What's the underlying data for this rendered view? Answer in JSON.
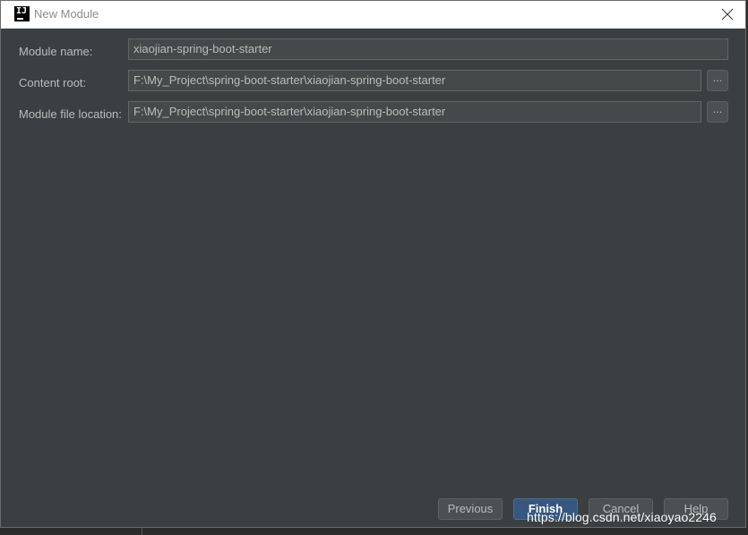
{
  "window": {
    "title": "New Module",
    "app_icon_text": "IJ"
  },
  "form": {
    "module_name": {
      "label": "Module name:",
      "value": "xiaojian-spring-boot-starter"
    },
    "content_root": {
      "label": "Content root:",
      "value": "F:\\My_Project\\spring-boot-starter\\xiaojian-spring-boot-starter",
      "browse_label": "..."
    },
    "module_file_location": {
      "label": "Module file location:",
      "value": "F:\\My_Project\\spring-boot-starter\\xiaojian-spring-boot-starter",
      "browse_label": "..."
    }
  },
  "buttons": {
    "previous": "Previous",
    "finish": "Finish",
    "cancel": "Cancel",
    "help": "Help"
  },
  "watermark": "https://blog.csdn.net/xiaoyao2246",
  "colors": {
    "dialog_bg": "#3c3f41",
    "field_bg": "#45494a",
    "primary_button": "#365880",
    "text": "#bbbbbb"
  },
  "icons": {
    "app": "intellij-idea-icon",
    "close": "close-icon"
  }
}
